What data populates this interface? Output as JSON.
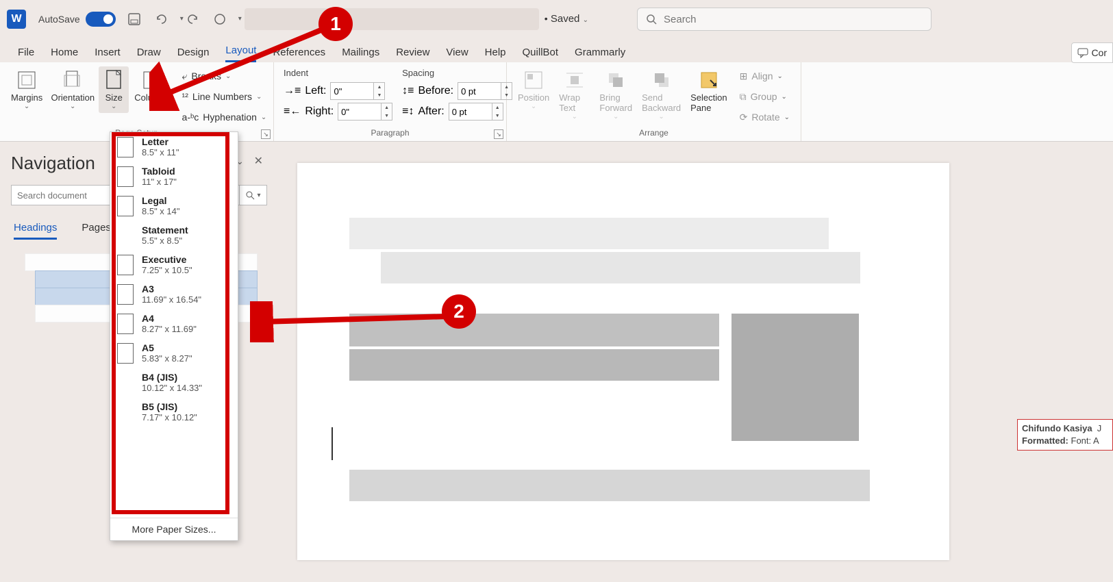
{
  "titlebar": {
    "autosave": "AutoSave",
    "saved": "Saved",
    "search_ph": "Search",
    "far_btn": "Cor",
    "word_initial": "W"
  },
  "tabs": [
    "File",
    "Home",
    "Insert",
    "Draw",
    "Design",
    "Layout",
    "References",
    "Mailings",
    "Review",
    "View",
    "Help",
    "QuillBot",
    "Grammarly"
  ],
  "active_tab": "Layout",
  "pagesetup": {
    "margins": "Margins",
    "orientation": "Orientation",
    "size": "Size",
    "columns": "Columns",
    "breaks": "Breaks",
    "linenums": "Line Numbers",
    "hyphen": "Hyphenation",
    "label": "Page Setup"
  },
  "para": {
    "indent": "Indent",
    "spacing": "Spacing",
    "left": "Left:",
    "right": "Right:",
    "before": "Before:",
    "after": "After:",
    "left_v": "0\"",
    "right_v": "0\"",
    "before_v": "0 pt",
    "after_v": "0 pt",
    "label": "Paragraph"
  },
  "arrange": {
    "position": "Position",
    "wrap": "Wrap Text",
    "bring": "Bring Forward",
    "send": "Send Backward",
    "selpane": "Selection Pane",
    "align": "Align",
    "group": "Group",
    "rotate": "Rotate",
    "label": "Arrange"
  },
  "nav": {
    "title": "Navigation",
    "search_ph": "Search document",
    "tabs": [
      "Headings",
      "Pages"
    ],
    "active": "Headings"
  },
  "sizes": [
    {
      "name": "Letter",
      "dim": "8.5\" x 11\"",
      "icon": true
    },
    {
      "name": "Tabloid",
      "dim": "11\" x 17\"",
      "icon": true
    },
    {
      "name": "Legal",
      "dim": "8.5\" x 14\"",
      "icon": true
    },
    {
      "name": "Statement",
      "dim": "5.5\" x 8.5\"",
      "icon": false
    },
    {
      "name": "Executive",
      "dim": "7.25\" x 10.5\"",
      "icon": true
    },
    {
      "name": "A3",
      "dim": "11.69\" x 16.54\"",
      "icon": true
    },
    {
      "name": "A4",
      "dim": "8.27\" x 11.69\"",
      "icon": true
    },
    {
      "name": "A5",
      "dim": "5.83\" x 8.27\"",
      "icon": true
    },
    {
      "name": "B4 (JIS)",
      "dim": "10.12\" x 14.33\"",
      "icon": false
    },
    {
      "name": "B5 (JIS)",
      "dim": "7.17\" x 10.12\"",
      "icon": false
    }
  ],
  "more_sizes": "More Paper Sizes...",
  "comment": {
    "author": "Chifundo Kasiya",
    "label": "Formatted:",
    "detail": "Font: A"
  },
  "ann": {
    "one": "1",
    "two": "2"
  }
}
